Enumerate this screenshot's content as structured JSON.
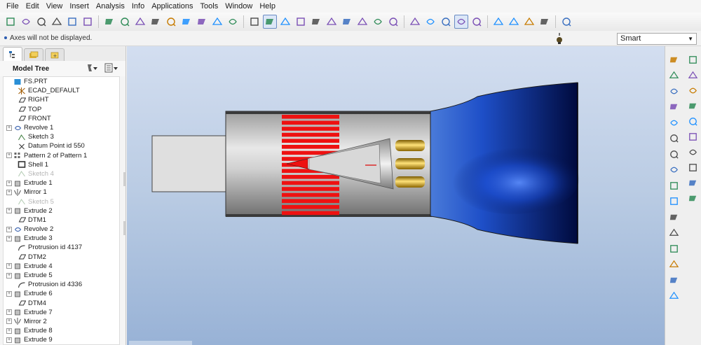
{
  "menu": [
    "File",
    "Edit",
    "View",
    "Insert",
    "Analysis",
    "Info",
    "Applications",
    "Tools",
    "Window",
    "Help"
  ],
  "toolbar": {
    "groups": [
      [
        "new-icon",
        "open-icon",
        "save-icon",
        "print-icon",
        "email-icon",
        "preview-icon"
      ],
      [
        "undo-icon",
        "redo-icon",
        "cut-icon",
        "copy-icon",
        "paste-icon",
        "paste-special-icon",
        "regenerate-icon",
        "find-icon",
        "select-box-icon"
      ],
      [
        "repaint-icon",
        "spin-center-icon",
        "orient-icon",
        "appearance-icon",
        "zoom-in-icon",
        "zoom-out-icon",
        "refit-icon",
        "reorient-icon",
        "saved-views-icon",
        "layers-icon"
      ],
      [
        "wireframe-icon",
        "hidden-line-icon",
        "no-hidden-icon",
        "shading-icon",
        "enhanced-realism-icon"
      ],
      [
        "datum-planes-icon",
        "datum-axes-icon",
        "point-display-icon",
        "csys-display-icon"
      ],
      [
        "whats-this-icon"
      ]
    ],
    "active": [
      "spin-center-icon",
      "shading-icon"
    ]
  },
  "status": {
    "message": "Axes will not be displayed.",
    "filter_value": "Smart"
  },
  "model_tree": {
    "title": "Model Tree",
    "items": [
      {
        "label": "FS.PRT",
        "icon": "part-icon",
        "expandable": false,
        "disabled": false,
        "indent": 0
      },
      {
        "label": "ECAD_DEFAULT",
        "icon": "csys-icon",
        "expandable": false,
        "disabled": false,
        "indent": 1
      },
      {
        "label": "RIGHT",
        "icon": "datum-plane-icon",
        "expandable": false,
        "disabled": false,
        "indent": 1
      },
      {
        "label": "TOP",
        "icon": "datum-plane-icon",
        "expandable": false,
        "disabled": false,
        "indent": 1
      },
      {
        "label": "FRONT",
        "icon": "datum-plane-icon",
        "expandable": false,
        "disabled": false,
        "indent": 1
      },
      {
        "label": "Revolve 1",
        "icon": "revolve-icon",
        "expandable": true,
        "disabled": false,
        "indent": 0
      },
      {
        "label": "Sketch 3",
        "icon": "sketch-icon",
        "expandable": false,
        "disabled": false,
        "indent": 1
      },
      {
        "label": "Datum Point id 550",
        "icon": "datum-point-icon",
        "expandable": false,
        "disabled": false,
        "indent": 1
      },
      {
        "label": "Pattern 2 of Pattern 1",
        "icon": "pattern-icon",
        "expandable": true,
        "disabled": false,
        "indent": 0
      },
      {
        "label": "Shell 1",
        "icon": "shell-icon",
        "expandable": false,
        "disabled": false,
        "indent": 1
      },
      {
        "label": "Sketch 4",
        "icon": "sketch-icon",
        "expandable": false,
        "disabled": true,
        "indent": 1
      },
      {
        "label": "Extrude 1",
        "icon": "extrude-icon",
        "expandable": true,
        "disabled": false,
        "indent": 0
      },
      {
        "label": "Mirror 1",
        "icon": "mirror-icon",
        "expandable": true,
        "disabled": false,
        "indent": 0
      },
      {
        "label": "Sketch 5",
        "icon": "sketch-icon",
        "expandable": false,
        "disabled": true,
        "indent": 1
      },
      {
        "label": "Extrude 2",
        "icon": "extrude-icon",
        "expandable": true,
        "disabled": false,
        "indent": 0
      },
      {
        "label": "DTM1",
        "icon": "datum-plane-icon",
        "expandable": false,
        "disabled": false,
        "indent": 1
      },
      {
        "label": "Revolve 2",
        "icon": "revolve-icon",
        "expandable": true,
        "disabled": false,
        "indent": 0
      },
      {
        "label": "Extrude 3",
        "icon": "extrude-icon",
        "expandable": true,
        "disabled": false,
        "indent": 0
      },
      {
        "label": "Protrusion id 4137",
        "icon": "protrusion-icon",
        "expandable": false,
        "disabled": false,
        "indent": 1
      },
      {
        "label": "DTM2",
        "icon": "datum-plane-icon",
        "expandable": false,
        "disabled": false,
        "indent": 1
      },
      {
        "label": "Extrude 4",
        "icon": "extrude-icon",
        "expandable": true,
        "disabled": false,
        "indent": 0
      },
      {
        "label": "Extrude 5",
        "icon": "extrude-icon",
        "expandable": true,
        "disabled": false,
        "indent": 0
      },
      {
        "label": "Protrusion id 4336",
        "icon": "protrusion-icon",
        "expandable": false,
        "disabled": false,
        "indent": 1
      },
      {
        "label": "Extrude 6",
        "icon": "extrude-icon",
        "expandable": true,
        "disabled": false,
        "indent": 0
      },
      {
        "label": "DTM4",
        "icon": "datum-plane-icon",
        "expandable": false,
        "disabled": false,
        "indent": 1
      },
      {
        "label": "Extrude 7",
        "icon": "extrude-icon",
        "expandable": true,
        "disabled": false,
        "indent": 0
      },
      {
        "label": "Mirror 2",
        "icon": "mirror-icon",
        "expandable": true,
        "disabled": false,
        "indent": 0
      },
      {
        "label": "Extrude 8",
        "icon": "extrude-icon",
        "expandable": true,
        "disabled": false,
        "indent": 0
      },
      {
        "label": "Extrude 9",
        "icon": "extrude-icon",
        "expandable": true,
        "disabled": false,
        "indent": 0
      }
    ]
  },
  "right_toolbar": {
    "left_column": [
      "datum-plane-tool-icon",
      "datum-axis-tool-icon",
      "datum-curve-tool-icon",
      "sketched-curve-tool-icon",
      "datum-point-tool-icon",
      "csys-tool-icon",
      "analysis-feature-icon",
      "cable-tool-icon",
      "placed-feature-icon",
      "hole-tool-icon",
      "round-tool-icon",
      "chamfer-tool-icon",
      "draft-tool-icon",
      "shell-tool-icon",
      "rib-tool-icon",
      "pattern-tool-icon"
    ],
    "right_column": [
      "extrude-tool-icon",
      "revolve-tool-icon",
      "sweep-tool-icon",
      "blend-tool-icon",
      "variable-sweep-icon",
      "boundary-blend-icon",
      "merge-tool-icon",
      "trim-tool-icon",
      "offset-tool-icon",
      "mirror-tool-icon"
    ]
  },
  "colors": {
    "graphics_top": "#d3def0",
    "graphics_bottom": "#98b2d6",
    "nozzle_dark": "#000a3d",
    "nozzle_bright": "#2f6bff",
    "fins_red": "#ee1111",
    "body_silver": "#c8c8c8",
    "brass": "#d4a017"
  }
}
